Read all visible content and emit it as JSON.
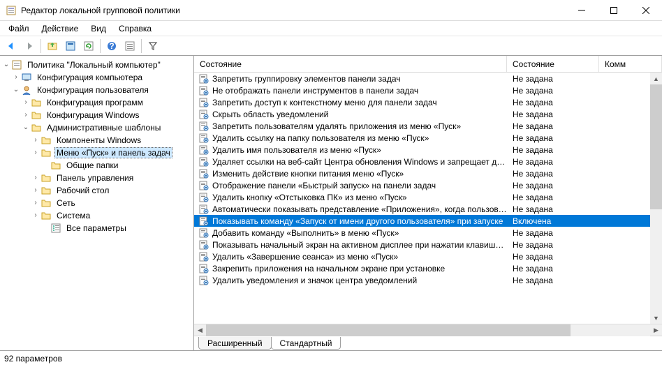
{
  "window": {
    "title": "Редактор локальной групповой политики"
  },
  "menu": {
    "file": "Файл",
    "action": "Действие",
    "view": "Вид",
    "help": "Справка"
  },
  "tree": {
    "root": "Политика \"Локальный компьютер\"",
    "computer_cfg": "Конфигурация компьютера",
    "user_cfg": "Конфигурация пользователя",
    "prog_cfg": "Конфигурация программ",
    "win_cfg": "Конфигурация Windows",
    "admin_tmpl": "Административные шаблоны",
    "win_components": "Компоненты Windows",
    "start_taskbar": "Меню «Пуск» и панель задач",
    "shared_folders": "Общие папки",
    "control_panel": "Панель управления",
    "desktop": "Рабочий стол",
    "network": "Сеть",
    "system": "Система",
    "all_params": "Все параметры"
  },
  "list": {
    "columns": {
      "state_l": "Состояние",
      "state_r": "Состояние",
      "comment": "Комм"
    },
    "state_notset": "Не задана",
    "state_enabled": "Включена",
    "items": [
      "Запретить группировку элементов панели задач",
      "Не отображать панели инструментов в панели задач",
      "Запретить доступ к контекстному меню для панели задач",
      "Скрыть область уведомлений",
      "Запретить пользователям удалять приложения из меню «Пуск»",
      "Удалить ссылку на папку пользователя из меню «Пуск»",
      "Удалить имя пользователя из меню «Пуск»",
      "Удаляет ссылки на веб-сайт Центра обновления Windows и запрещает досту...",
      "Изменить действие кнопки питания меню «Пуск»",
      "Отображение панели «Быстрый запуск» на панели задач",
      "Удалить кнопку «Отстыковка ПК» из меню «Пуск»",
      "Автоматически показывать представление «Приложения», когда пользовате...",
      "Показывать команду «Запуск от имени другого пользователя» при запуске",
      "Добавить команду «Выполнить» в меню «Пуск»",
      "Показывать начальный экран на активном дисплее при нажатии клавиши W...",
      "Удалить «Завершение сеанса» из меню «Пуск»",
      "Закрепить приложения на начальном экране при установке",
      "Удалить уведомления и значок центра уведомлений"
    ],
    "selected_index": 12
  },
  "tabs": {
    "extended": "Расширенный",
    "standard": "Стандартный"
  },
  "status": {
    "text": "92 параметров"
  }
}
